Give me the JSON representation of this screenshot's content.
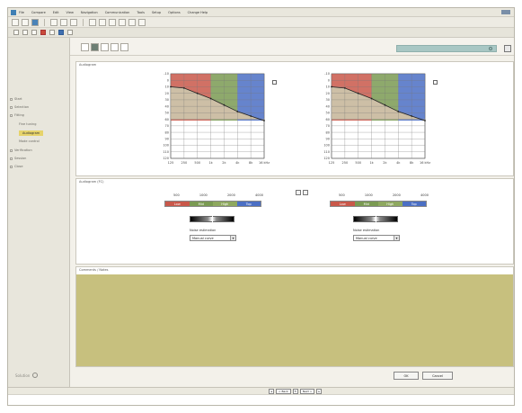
{
  "menubar": {
    "items": [
      "File",
      "Compare",
      "Edit",
      "View",
      "Navigation",
      "Communication",
      "Tools",
      "Setup",
      "Options",
      "Change Help"
    ]
  },
  "sidebar": {
    "items": [
      {
        "label": "Start",
        "level": 0
      },
      {
        "label": "Selection",
        "level": 0
      },
      {
        "label": "Fitting",
        "level": 0
      },
      {
        "label": "Fine tuning",
        "level": 1
      },
      {
        "label": "Audiogram",
        "level": 1,
        "active": true
      },
      {
        "label": "Mode control",
        "level": 1
      },
      {
        "label": "Verification",
        "level": 0
      },
      {
        "label": "Session",
        "level": 0
      },
      {
        "label": "Close",
        "level": 0
      }
    ],
    "logo_text": "Solution"
  },
  "audiogram": {
    "section_title": "Audiogram",
    "y_ticks": [
      "-10",
      "0",
      "10",
      "20",
      "30",
      "40",
      "50",
      "60",
      "70",
      "80",
      "90",
      "100",
      "110",
      "120"
    ],
    "x_ticks": [
      "125",
      "250",
      "500",
      "1k",
      "2k",
      "4k",
      "8k",
      "16 kHz"
    ],
    "threshold_db": [
      10,
      12,
      20,
      28,
      38,
      48,
      55,
      62
    ],
    "colors": {
      "red": "#c9584a",
      "green": "#7a9a52",
      "blue": "#4b6fc4",
      "shade": "#cdbfa6"
    }
  },
  "settings": {
    "section_title": "Audiogram (FC)",
    "freq_labels": [
      "500",
      "1000",
      "2000",
      "4000"
    ],
    "band_labels": [
      "Low",
      "Mid",
      "High",
      "Top"
    ],
    "band_colors": [
      "#c9584a",
      "#7a9a52",
      "#8ea85f",
      "#4b6fc4"
    ],
    "select_label": "Noise estimation",
    "select_value": "Manual curve"
  },
  "notes": {
    "section_title": "Comments / Notes"
  },
  "footer": {
    "ok_label": "OK",
    "cancel_label": "Cancel"
  },
  "statusbar": {
    "back_label": "< Back",
    "next_label": "Next >"
  }
}
